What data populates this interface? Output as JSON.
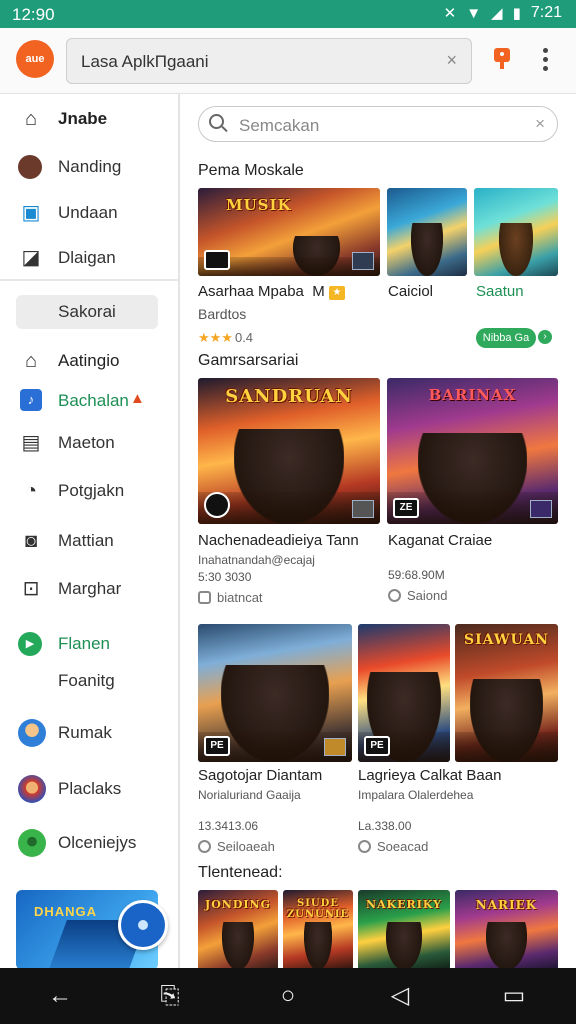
{
  "status": {
    "time_left": "12:90",
    "time_right": "7:21",
    "icons": [
      "mute-icon",
      "wifi-icon",
      "signal-icon",
      "battery-icon"
    ]
  },
  "topbar": {
    "logo_text": "aue",
    "address": "Lasa AplkПgaani",
    "clear_glyph": "×"
  },
  "sidebar": {
    "items": [
      {
        "label": "Jnabe",
        "icon": "home-icon"
      },
      {
        "label": "Nanding",
        "icon": "avatar-icon"
      },
      {
        "label": "Undaan",
        "icon": "card-icon"
      },
      {
        "label": "Dlaigan",
        "icon": "frame-icon"
      }
    ],
    "pill": "Sakorai",
    "items2": [
      {
        "label": "Aatingio",
        "icon": "house-icon"
      },
      {
        "label": "Bachalan",
        "icon": "link-icon"
      },
      {
        "label": "Maeton",
        "icon": "list-icon"
      },
      {
        "label": "Potgjakn",
        "icon": "chat-icon"
      },
      {
        "label": "Mattian",
        "icon": "camera-icon"
      },
      {
        "label": "Marghar",
        "icon": "square-icon"
      },
      {
        "label": "Flanen",
        "icon": "play-icon"
      },
      {
        "label": "Foanitg",
        "icon": ""
      },
      {
        "label": "Rumak",
        "icon": "avatar-icon"
      },
      {
        "label": "Placlaks",
        "icon": "avatar-icon"
      },
      {
        "label": "Olceniejys",
        "icon": "avatar-icon"
      }
    ],
    "banner_text": "DHANGA"
  },
  "main": {
    "search_placeholder": "Semcakan",
    "search_clear": "×",
    "section1": "Pema Moskale",
    "row1": {
      "thumb_title": "MUSIK",
      "card1_title": "Asarhaa Mpaba",
      "card1_tag": "M",
      "card1_sub": "Bardtos",
      "card1_rating": "★★★",
      "card1_rating_num": "0.4",
      "card2_title": "Caiciol",
      "card3_title": "Saatun",
      "install_label": "Nibba Ga"
    },
    "section2": "Gamrsarsariai",
    "row2": [
      {
        "thumb_title": "SANDRUAN",
        "rating_badge": "ZE",
        "title": "Nachenadeadieiya Tann",
        "sub": "Inahatnandah@ecajaj",
        "price": "5:30 3030",
        "meta": "biatncat"
      },
      {
        "thumb_title": "BARINAX",
        "rating_badge": "ZE",
        "title": "Kaganat Craiae",
        "price": "59:68.90M",
        "meta": "Saiond"
      }
    ],
    "row3": [
      {
        "thumb_title": "",
        "rating_badge": "PE",
        "title": "Sagotojar Diantam",
        "sub": "Norialuriand Gaaija",
        "price": "13.3413.06",
        "meta": "Seiloaeah"
      },
      {
        "thumb_title": "",
        "rating_badge": "PE",
        "title": "Lagrieya Calkat Baan",
        "sub": "Impalara Olalerdehea",
        "price": "La.338.00",
        "meta": "Soeacad"
      },
      {
        "thumb_title": "SIAWUAN"
      }
    ],
    "section4": "Tlentenead:",
    "row4": [
      {
        "thumb_title": "JONDING"
      },
      {
        "thumb_title": "SIUDE ZUNUNIE"
      },
      {
        "thumb_title": "NAKERIKY"
      },
      {
        "thumb_title": "NARIEK"
      }
    ]
  },
  "navbar": {
    "buttons": [
      "back-icon",
      "recents-icon",
      "home-icon",
      "triangle-icon",
      "menu-icon"
    ]
  }
}
